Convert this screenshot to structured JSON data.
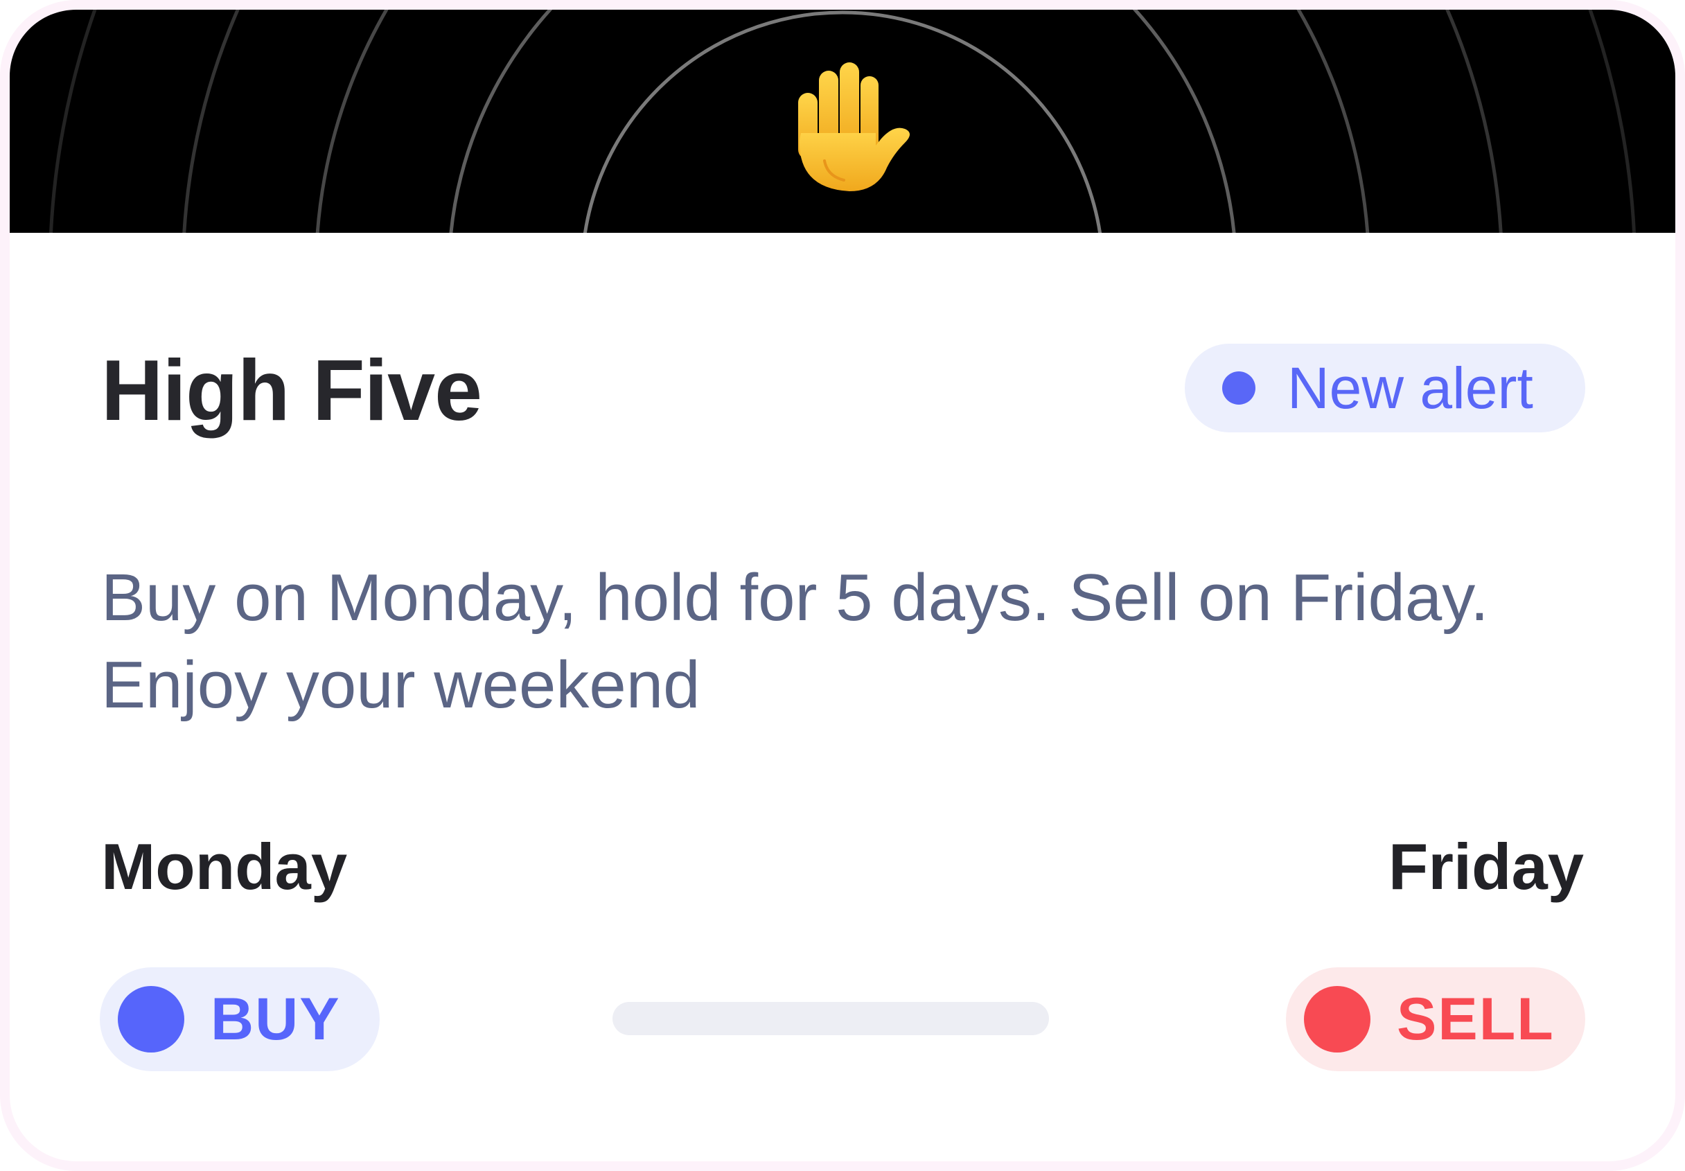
{
  "header": {
    "emoji_icon": "raised-hand-icon"
  },
  "card": {
    "title": "High Five",
    "badge": {
      "label": "New alert",
      "color": "#5967f7"
    },
    "description": "Buy on Monday, hold for 5 days. Sell on Friday. Enjoy your weekend",
    "start_day": "Monday",
    "end_day": "Friday",
    "buy": {
      "label": "BUY",
      "color": "#5665fb"
    },
    "sell": {
      "label": "SELL",
      "color": "#f84a53"
    },
    "hold_progress": 0
  }
}
